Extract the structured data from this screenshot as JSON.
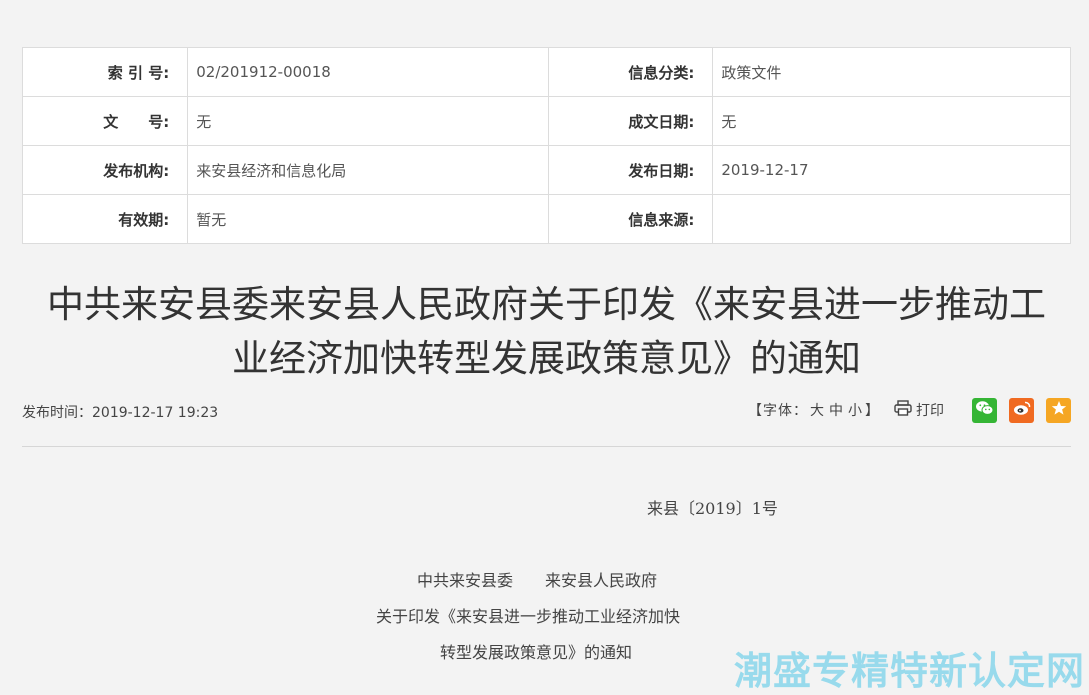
{
  "meta": {
    "index_label": "索 引 号:",
    "index_value": "02/201912-00018",
    "category_label": "信息分类:",
    "category_value": "政策文件",
    "docno_label": "文　　号:",
    "docno_value": "无",
    "created_label": "成文日期:",
    "created_value": "无",
    "issuer_label": "发布机构:",
    "issuer_value": "来安县经济和信息化局",
    "pubdate_label": "发布日期:",
    "pubdate_value": "2019-12-17",
    "validity_label": "有效期:",
    "validity_value": "暂无",
    "source_label": "信息来源:",
    "source_value": ""
  },
  "article": {
    "title_line1": "中共来安县委来安县人民政府关于印发《来安县进一步推动工",
    "title_line2": "业经济加快转型发展政策意见》的通知",
    "publish_time": "发布时间：2019-12-17 19:23"
  },
  "tools": {
    "font_prefix": "【字体：",
    "font_large": "大",
    "font_medium": "中",
    "font_small": "小",
    "font_suffix": "】",
    "print_label": "打印",
    "share_icons": [
      "wechat-icon",
      "weibo-icon",
      "favorite-icon"
    ]
  },
  "body": {
    "doc_number": "来县〔2019〕1号",
    "issuers": "中共来安县委　　来安县人民政府",
    "subject_line1": "关于印发《来安县进一步推动工业经济加快",
    "subject_line2": "转型发展政策意见》的通知"
  },
  "watermark": "潮盛专精特新认定网",
  "colors": {
    "background": "#f3f3f3",
    "wechat": "#35b535",
    "weibo": "#f06a21",
    "favorite": "#f5a623",
    "watermark": "#8fd8ec"
  }
}
